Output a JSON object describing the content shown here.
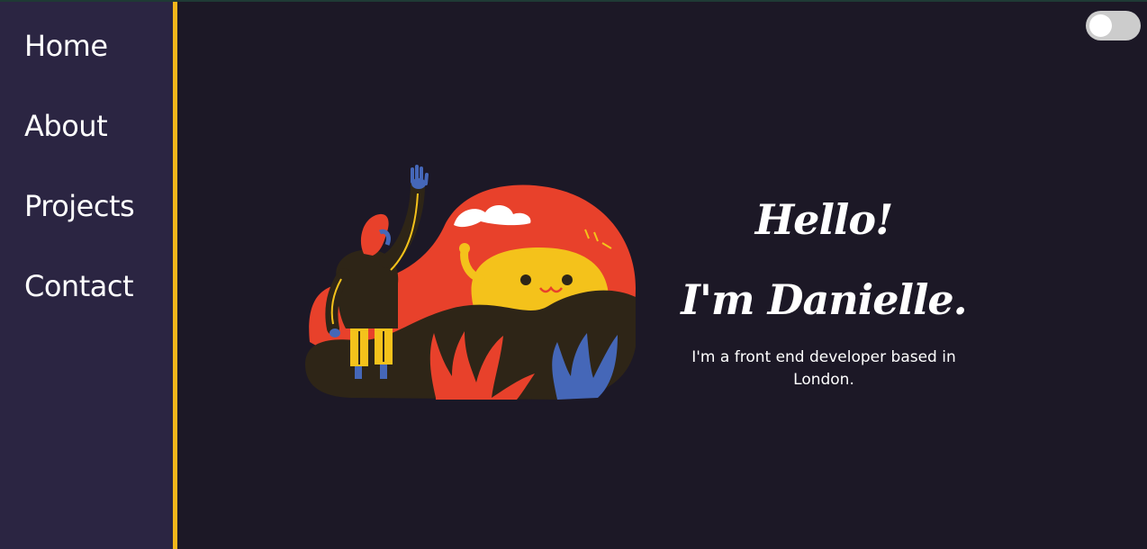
{
  "nav": {
    "items": [
      {
        "label": "Home"
      },
      {
        "label": "About"
      },
      {
        "label": "Projects"
      },
      {
        "label": "Contact"
      }
    ]
  },
  "theme_toggle": {
    "state": "off"
  },
  "hero": {
    "greeting": "Hello!",
    "name_line": "I'm Danielle.",
    "tagline_line1": "I'm a front end developer based in",
    "tagline_line2": "London."
  },
  "colors": {
    "background": "#1c1826",
    "sidebar": "#2b2542",
    "accent": "#f2b61b",
    "illustration_red": "#e8412b",
    "illustration_yellow": "#f4c21b",
    "illustration_blue": "#4567b8"
  }
}
